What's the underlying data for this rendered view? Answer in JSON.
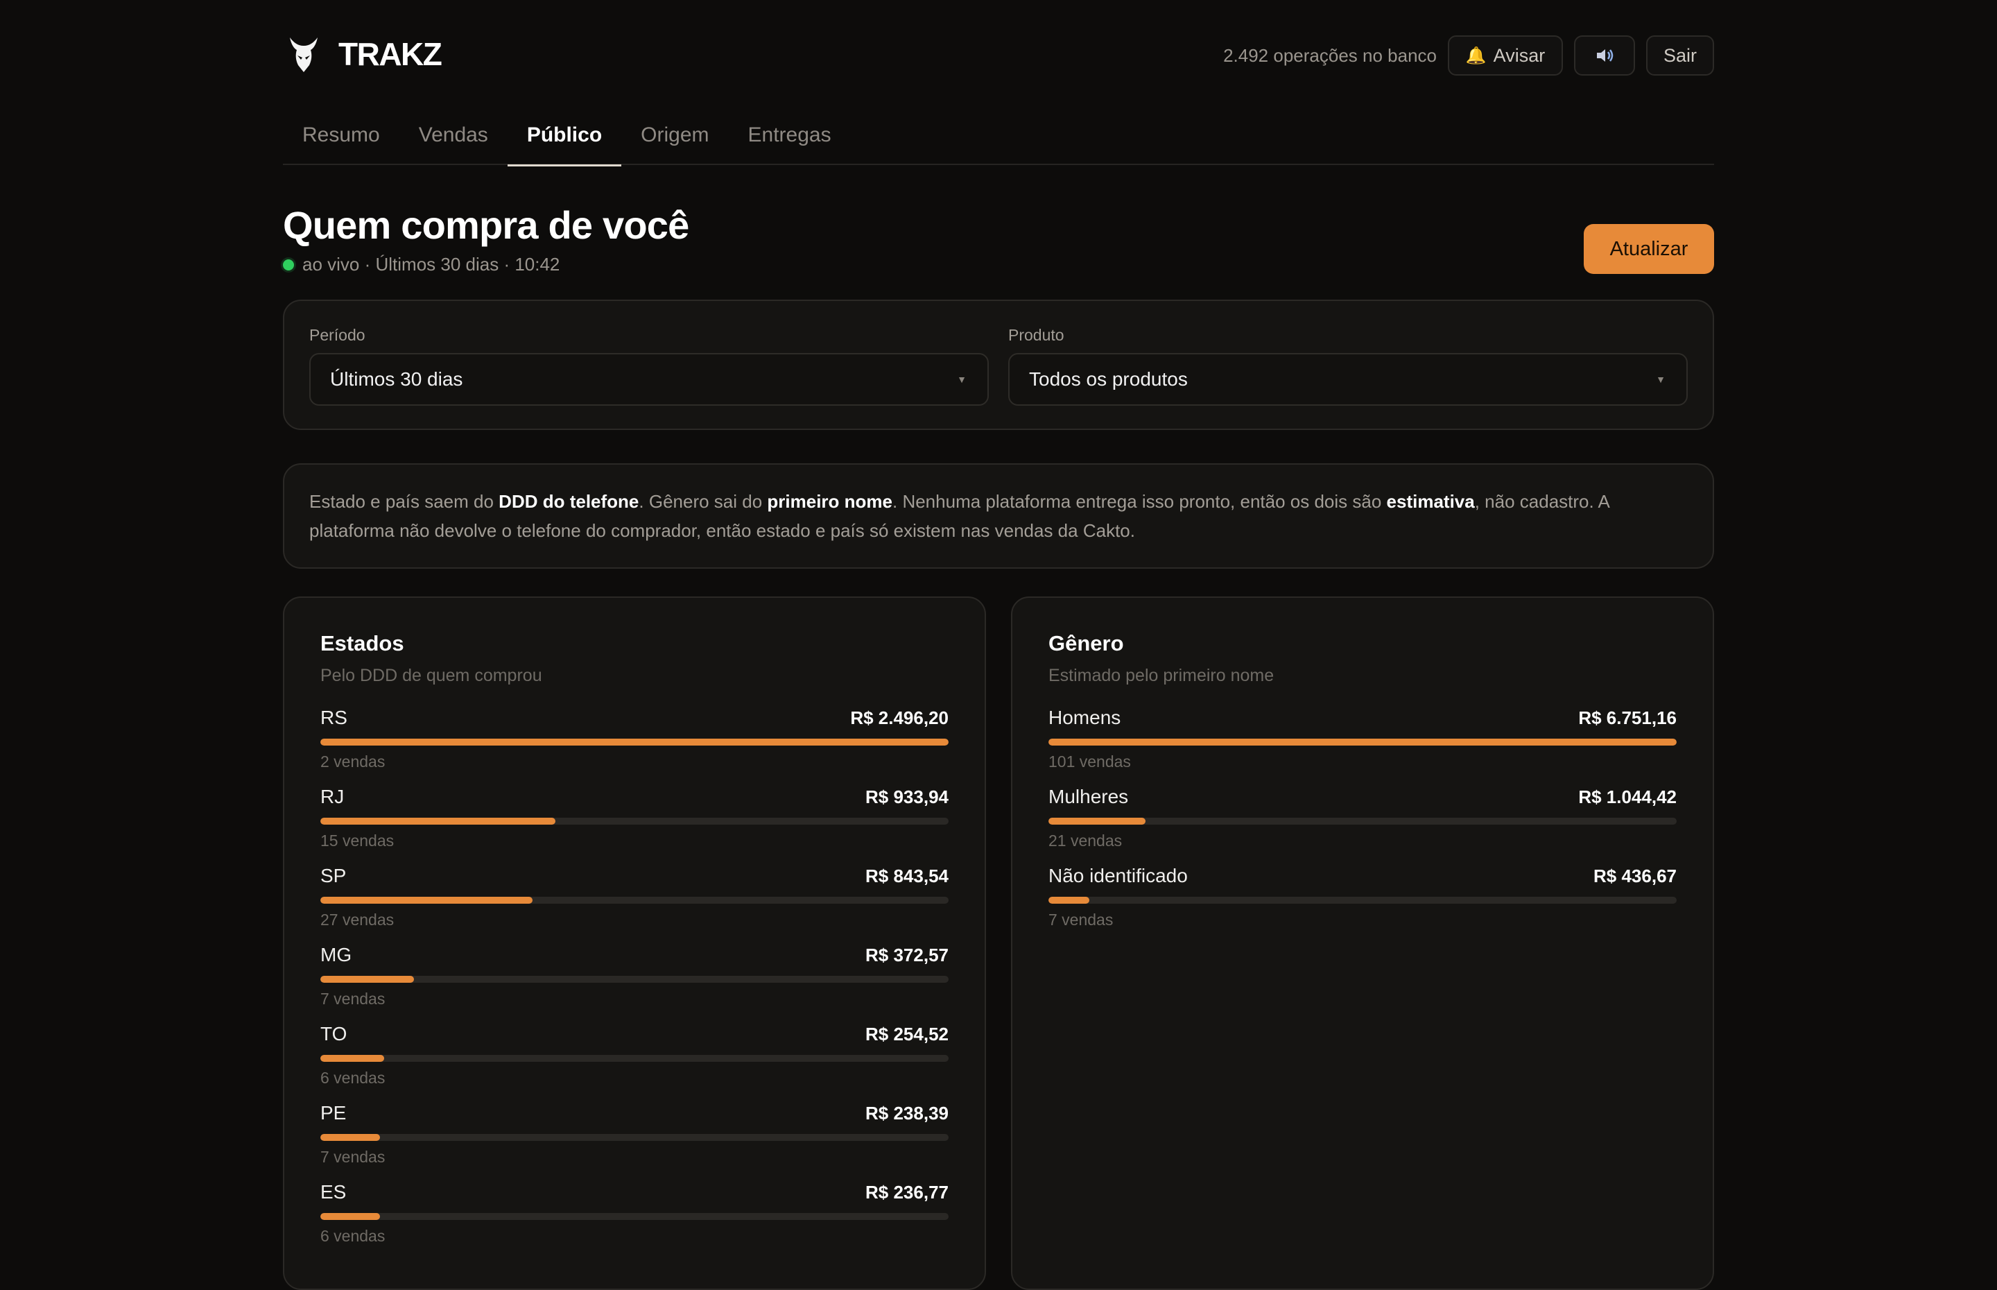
{
  "header": {
    "brand": "TRAKZ",
    "ops_text": "2.492 operações no banco",
    "avisar_label": "Avisar",
    "sair_label": "Sair"
  },
  "tabs": [
    {
      "label": "Resumo",
      "active": false
    },
    {
      "label": "Vendas",
      "active": false
    },
    {
      "label": "Público",
      "active": true
    },
    {
      "label": "Origem",
      "active": false
    },
    {
      "label": "Entregas",
      "active": false
    }
  ],
  "page": {
    "title": "Quem compra de você",
    "status": "ao vivo · Últimos 30 dias · 10:42",
    "refresh_label": "Atualizar"
  },
  "filters": {
    "period_label": "Período",
    "period_value": "Últimos 30 dias",
    "product_label": "Produto",
    "product_value": "Todos os produtos"
  },
  "info": {
    "t1": "Estado e país saem do ",
    "b1": "DDD do telefone",
    "t2": ". Gênero sai do ",
    "b2": "primeiro nome",
    "t3": ". Nenhuma plataforma entrega isso pronto, então os dois são ",
    "b3": "estimativa",
    "t4": ", não cadastro. A plataforma não devolve o telefone do comprador, então estado e país só existem nas vendas da Cakto."
  },
  "states_panel": {
    "title": "Estados",
    "subtitle": "Pelo DDD de quem comprou",
    "rows": [
      {
        "label": "RS",
        "value": "R$ 2.496,20",
        "count": "2 vendas",
        "share": 1.0
      },
      {
        "label": "RJ",
        "value": "R$ 933,94",
        "count": "15 vendas",
        "share": 0.374
      },
      {
        "label": "SP",
        "value": "R$ 843,54",
        "count": "27 vendas",
        "share": 0.338
      },
      {
        "label": "MG",
        "value": "R$ 372,57",
        "count": "7 vendas",
        "share": 0.149
      },
      {
        "label": "TO",
        "value": "R$ 254,52",
        "count": "6 vendas",
        "share": 0.102
      },
      {
        "label": "PE",
        "value": "R$ 238,39",
        "count": "7 vendas",
        "share": 0.095
      },
      {
        "label": "ES",
        "value": "R$ 236,77",
        "count": "6 vendas",
        "share": 0.095
      }
    ]
  },
  "gender_panel": {
    "title": "Gênero",
    "subtitle": "Estimado pelo primeiro nome",
    "rows": [
      {
        "label": "Homens",
        "value": "R$ 6.751,16",
        "count": "101 vendas",
        "share": 1.0
      },
      {
        "label": "Mulheres",
        "value": "R$ 1.044,42",
        "count": "21 vendas",
        "share": 0.155
      },
      {
        "label": "Não identificado",
        "value": "R$ 436,67",
        "count": "7 vendas",
        "share": 0.065
      }
    ]
  },
  "colors": {
    "accent": "#e78a39",
    "live": "#2fcf5e",
    "background": "#0d0c0b",
    "card": "#151412"
  }
}
